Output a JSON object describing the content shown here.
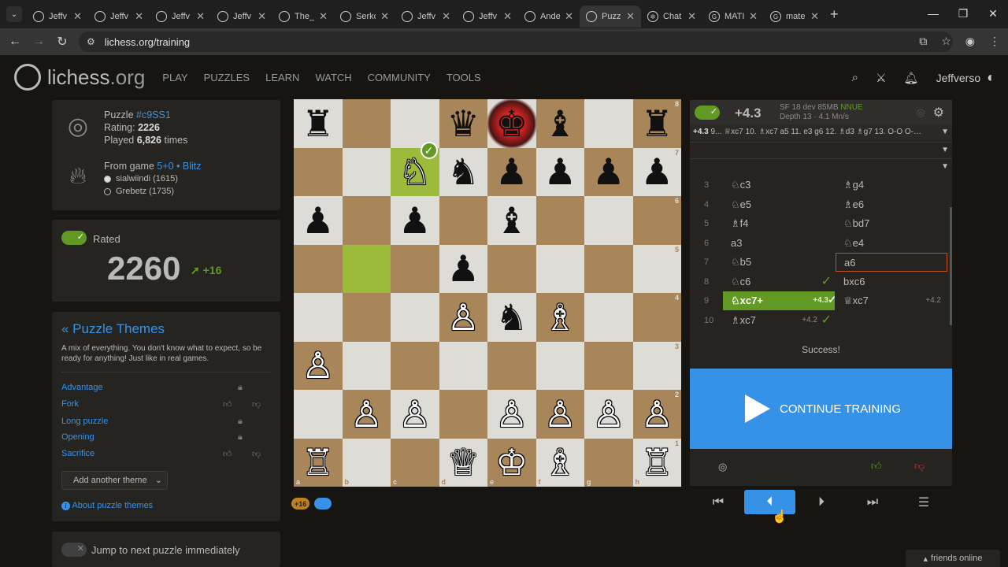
{
  "browser": {
    "tabs": [
      {
        "title": "Jeffv",
        "icon": "lichess-icon"
      },
      {
        "title": "Jeffv",
        "icon": "lichess-icon"
      },
      {
        "title": "Jeffv",
        "icon": "lichess-icon"
      },
      {
        "title": "Jeffv",
        "icon": "lichess-icon"
      },
      {
        "title": "The_l",
        "icon": "lichess-icon"
      },
      {
        "title": "Serkc",
        "icon": "lichess-icon"
      },
      {
        "title": "Jeffv",
        "icon": "lichess-icon"
      },
      {
        "title": "Jeffv",
        "icon": "lichess-icon"
      },
      {
        "title": "Ande",
        "icon": "lichess-icon"
      },
      {
        "title": "Puzz",
        "icon": "lichess-icon",
        "active": true
      },
      {
        "title": "Chat",
        "icon": "chatgpt-icon"
      },
      {
        "title": "MATI",
        "icon": "google-icon"
      },
      {
        "title": "mate",
        "icon": "google-icon"
      }
    ],
    "url": "lichess.org/training"
  },
  "site": {
    "logo_text": "lichess",
    "logo_suffix": ".org",
    "nav": [
      "PLAY",
      "PUZZLES",
      "LEARN",
      "WATCH",
      "COMMUNITY",
      "TOOLS"
    ],
    "username": "Jeffverso"
  },
  "puzzle": {
    "label": "Puzzle",
    "id": "#c9SS1",
    "rating_label": "Rating:",
    "rating": "2226",
    "played_label": "Played",
    "played_count": "6,826",
    "played_suffix": "times",
    "from_game_label": "From game",
    "game_link": "5+0 • Blitz",
    "players": [
      "sialwiindi (1615)",
      "Grebetz (1735)"
    ]
  },
  "rated": {
    "label": "Rated",
    "rating": "2260",
    "diff": "+16"
  },
  "themes": {
    "title": "« Puzzle Themes",
    "description": "A mix of everything. You don't know what to expect, so be ready for anything! Just like in real games.",
    "items": [
      "Advantage",
      "Fork",
      "Long puzzle",
      "Opening",
      "Sacrifice"
    ],
    "add_label": "Add another theme",
    "about_label": "About puzzle themes"
  },
  "jump": {
    "label": "Jump to next puzzle immediately"
  },
  "board": {
    "files": [
      "a",
      "b",
      "c",
      "d",
      "e",
      "f",
      "g",
      "h"
    ],
    "ranks": [
      "8",
      "7",
      "6",
      "5",
      "4",
      "3",
      "2",
      "1"
    ],
    "rows": [
      [
        "♜",
        "",
        "",
        "♛",
        "♚",
        "♝",
        "",
        "♜"
      ],
      [
        "",
        "",
        "♘",
        "♞",
        "♟",
        "♟",
        "♟",
        "♟"
      ],
      [
        "♟",
        "",
        "♟",
        "",
        "♝",
        "",
        "",
        ""
      ],
      [
        "",
        "",
        "",
        "♟",
        "",
        "",
        "",
        ""
      ],
      [
        "",
        "",
        "",
        "♙",
        "♞",
        "♗",
        "",
        ""
      ],
      [
        "♙",
        "",
        "",
        "",
        "",
        "",
        "",
        ""
      ],
      [
        "",
        "♙",
        "♙",
        "",
        "♙",
        "♙",
        "♙",
        "♙"
      ],
      [
        "♖",
        "",
        "",
        "♕",
        "♔",
        "♗",
        "",
        "♖"
      ]
    ],
    "white_pieces": [
      "♔",
      "♕",
      "♖",
      "♗",
      "♘",
      "♙"
    ],
    "success_mark": "✓"
  },
  "pills": [
    "+16",
    ""
  ],
  "engine": {
    "score": "+4.3",
    "info_line1": "SF 18 dev 85MB",
    "nnue": "NNUE",
    "info_line2": "Depth 13 · 4.1 Mn/s",
    "pv_score": "+4.3",
    "pv_moves": "9... ♕xc7 10. ♗xc7 a5 11. e3 g6 12. ♗d3 ♗g7 13. O-O O-…"
  },
  "moves": [
    {
      "n": "3",
      "w": "♘c3",
      "b": "♗g4"
    },
    {
      "n": "4",
      "w": "♘e5",
      "b": "♗e6"
    },
    {
      "n": "5",
      "w": "♗f4",
      "b": "♘bd7"
    },
    {
      "n": "6",
      "w": "a3",
      "b": "♘e4"
    },
    {
      "n": "7",
      "w": "♘b5",
      "b": "a6"
    },
    {
      "n": "8",
      "w": "♘c6",
      "b": "bxc6"
    },
    {
      "n": "9",
      "w": "♘xc7+",
      "w_eval": "+4.3",
      "b": "♕xc7",
      "b_eval": "+4.2"
    },
    {
      "n": "10",
      "w": "♗xc7",
      "w_eval": "+4.2",
      "b": ""
    }
  ],
  "success_text": "Success!",
  "continue_label": "CONTINUE TRAINING",
  "friends": "friends online"
}
